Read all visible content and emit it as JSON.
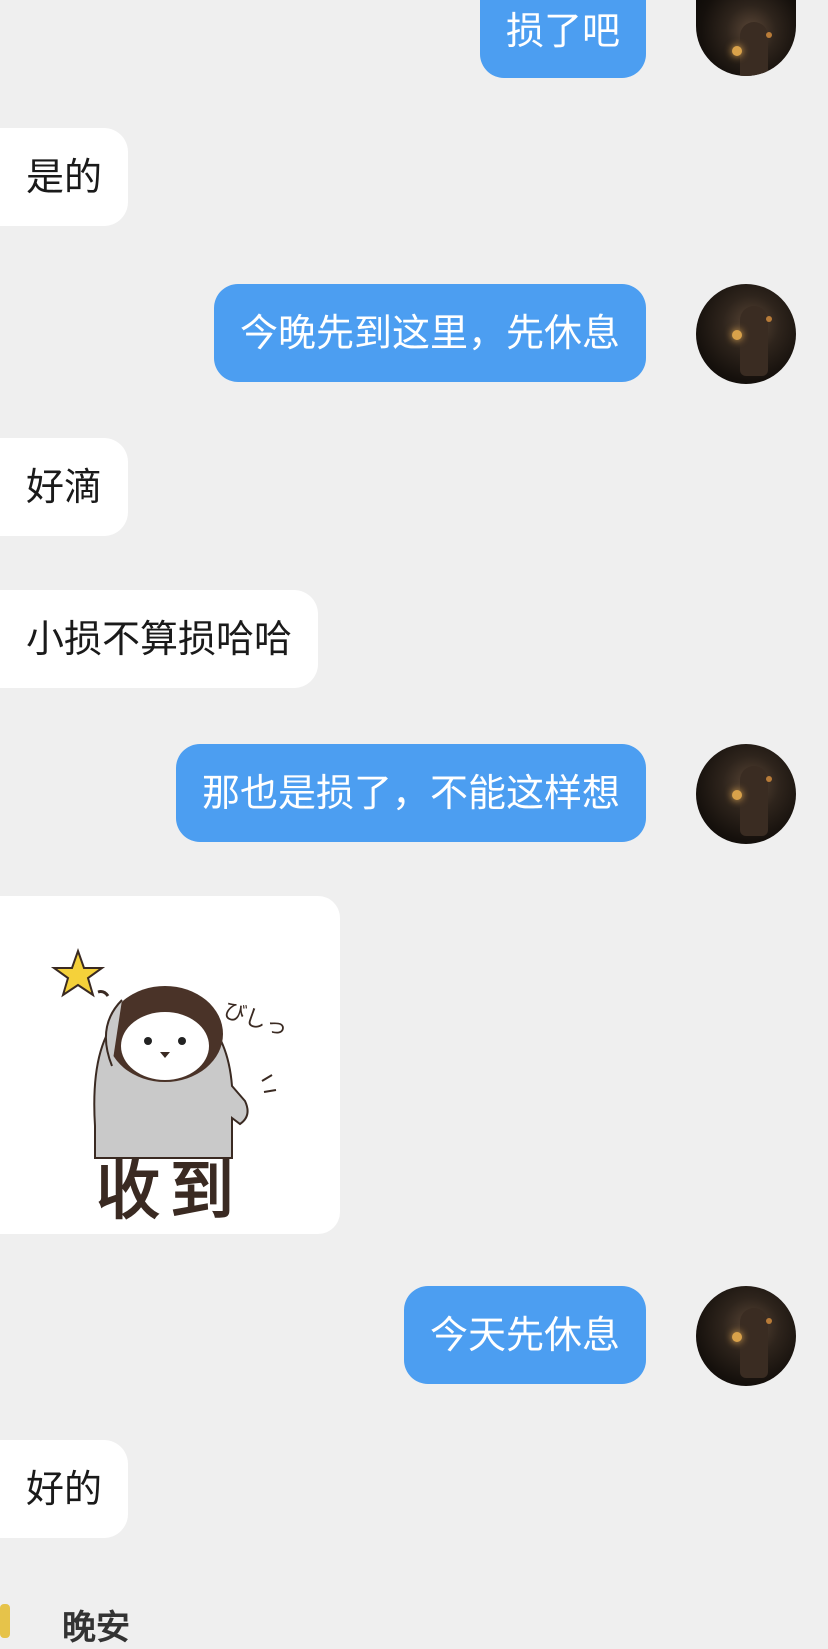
{
  "messages": [
    {
      "side": "right",
      "text": "损了吧"
    },
    {
      "side": "left",
      "text": "是的"
    },
    {
      "side": "right",
      "text": "今晚先到这里，先休息"
    },
    {
      "side": "left",
      "text": "好滴"
    },
    {
      "side": "left",
      "text": "小损不算损哈哈"
    },
    {
      "side": "right",
      "text": "那也是损了，不能这样想"
    },
    {
      "side": "left",
      "sticker": "penguin-salute",
      "caption": "收到",
      "annotation": "びしっ"
    },
    {
      "side": "right",
      "text": "今天先休息"
    },
    {
      "side": "left",
      "text": "好的"
    }
  ],
  "footer_sticker": {
    "text": "晚安"
  },
  "colors": {
    "background": "#efefef",
    "incoming_bubble": "#ffffff",
    "outgoing_bubble": "#4c9ef1",
    "outgoing_text": "#ffffff"
  }
}
